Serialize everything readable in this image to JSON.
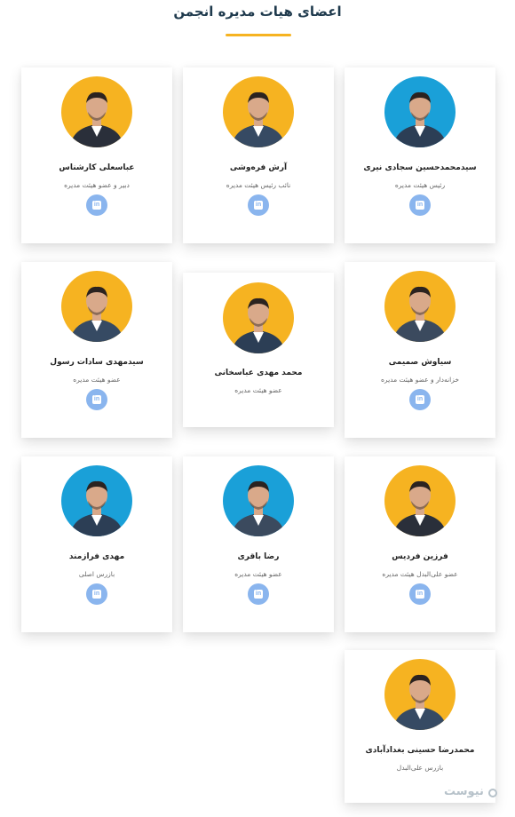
{
  "page": {
    "title": "اعضای هیات مدیره انجمن",
    "accent_color": "#f6b321",
    "linkedin_color": "#8ab5ee"
  },
  "members": [
    {
      "name": "سیدمحمدحسین سجادی نیری",
      "role": "رئیس هیئت مدیره",
      "avatar_bg": "#1aa0d8",
      "linkedin_label": "in",
      "icon": "linkedin-icon"
    },
    {
      "name": "آرش فره‌وشی",
      "role": "نائب رئیس هیئت مدیره",
      "avatar_bg": "#f6b321",
      "linkedin_label": "in",
      "icon": "linkedin-icon"
    },
    {
      "name": "عباسعلی کارشناس",
      "role": "دبیر و عضو هیئت مدیره",
      "avatar_bg": "#f6b321",
      "linkedin_label": "in",
      "icon": "linkedin-icon"
    },
    {
      "name": "سیاوش صمیمی",
      "role": "خزانه‌دار و عضو هیئت مدیره",
      "avatar_bg": "#f6b321",
      "linkedin_label": "in",
      "icon": "linkedin-icon"
    },
    {
      "name": "محمد مهدی عباسخانی",
      "role": "عضو هیئت مدیره",
      "avatar_bg": "#f6b321",
      "linkedin_label": "",
      "icon": ""
    },
    {
      "name": "سیدمهدی سادات رسول",
      "role": "عضو هیئت مدیره",
      "avatar_bg": "#f6b321",
      "linkedin_label": "in",
      "icon": "linkedin-icon"
    },
    {
      "name": "فرزین فردیس",
      "role": "عضو علی‌البدل هیئت مدیره",
      "avatar_bg": "#f6b321",
      "linkedin_label": "in",
      "icon": "linkedin-icon"
    },
    {
      "name": "رضا باقری",
      "role": "عضو هیئت مدیره",
      "avatar_bg": "#1aa0d8",
      "linkedin_label": "in",
      "icon": "linkedin-icon"
    },
    {
      "name": "مهدی فرازمند",
      "role": "بازرس اصلی",
      "avatar_bg": "#1aa0d8",
      "linkedin_label": "in",
      "icon": "linkedin-icon"
    },
    {
      "name": "محمدرضا حسینی بغدادآبادی",
      "role": "بازرس علی‌البدل",
      "avatar_bg": "#f6b321",
      "linkedin_label": "",
      "icon": ""
    }
  ],
  "watermark": {
    "text": "نیوست"
  }
}
